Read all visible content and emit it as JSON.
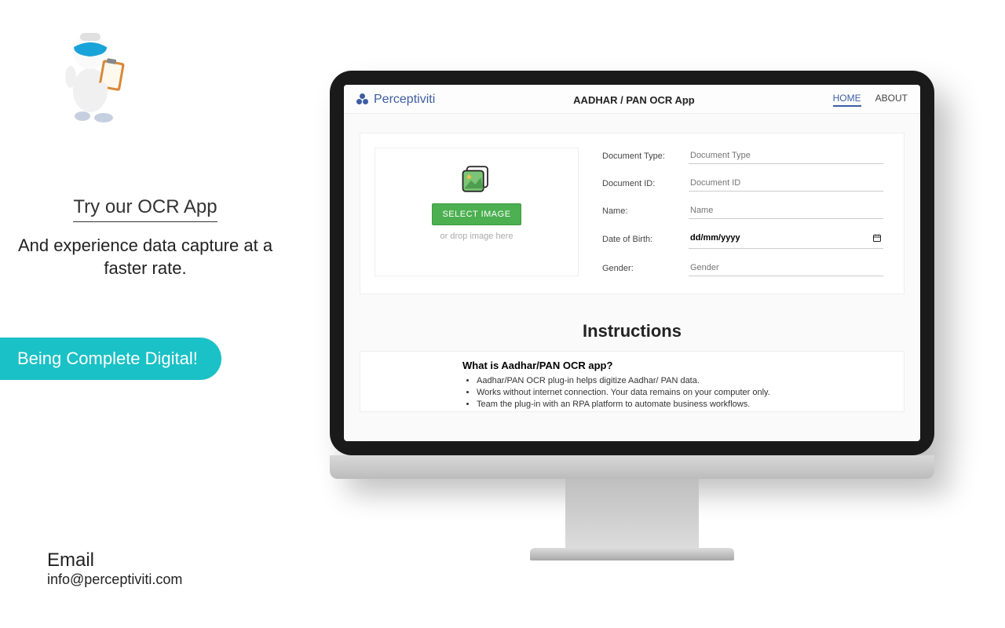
{
  "promo": {
    "title": "Try our OCR App",
    "text": "And experience data capture at a faster rate."
  },
  "cta": {
    "label": "Being Complete Digital!"
  },
  "contact": {
    "title": "Email",
    "value": "info@perceptiviti.com"
  },
  "screen": {
    "brand": "Perceptiviti",
    "app_title": "AADHAR / PAN OCR App",
    "nav": {
      "home": "HOME",
      "about": "ABOUT"
    },
    "upload": {
      "button": "SELECT IMAGE",
      "drop_text": "or drop image here"
    },
    "fields": {
      "doc_type": {
        "label": "Document Type:",
        "placeholder": "Document Type"
      },
      "doc_id": {
        "label": "Document ID:",
        "placeholder": "Document ID"
      },
      "name": {
        "label": "Name:",
        "placeholder": "Name"
      },
      "dob": {
        "label": "Date of Birth:",
        "placeholder": "dd/mm/yyyy"
      },
      "gender": {
        "label": "Gender:",
        "placeholder": "Gender"
      }
    },
    "instructions": {
      "heading": "Instructions",
      "subtitle": "What is Aadhar/PAN OCR app?",
      "bullets": [
        "Aadhar/PAN OCR plug-in helps digitize Aadhar/ PAN data.",
        "Works without internet connection. Your data remains on your computer only.",
        "Team the plug-in with an RPA platform to automate business workflows."
      ]
    }
  }
}
